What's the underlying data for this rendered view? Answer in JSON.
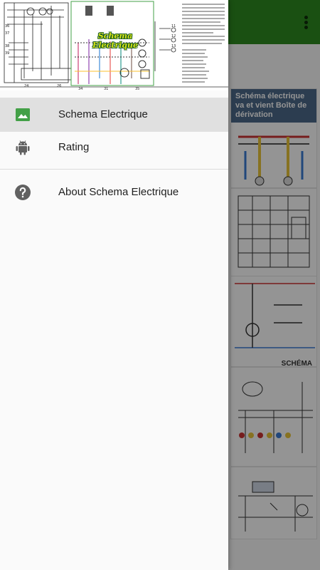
{
  "app": {
    "appbar_color": "#2e8b1f",
    "menu_icon": "more-vert-icon",
    "cards": [
      {
        "caption": "Schéma électrique va et vient Boîte de dérivation"
      },
      {
        "caption": ""
      },
      {
        "caption": "SCHÉMA ÉLECTRIQUE TROTTINETTE"
      },
      {
        "caption": ""
      },
      {
        "caption": ""
      }
    ]
  },
  "drawer": {
    "header": {
      "title": "Schema Electrique"
    },
    "items": [
      {
        "label": "Schema Electrique",
        "icon": "image-icon",
        "icon_color": "#43a047",
        "selected": true
      },
      {
        "label": "Rating",
        "icon": "android-icon",
        "icon_color": "#616161",
        "selected": false
      },
      {
        "label": "About Schema Electrique",
        "icon": "help-icon",
        "icon_color": "#616161",
        "selected": false
      }
    ]
  }
}
